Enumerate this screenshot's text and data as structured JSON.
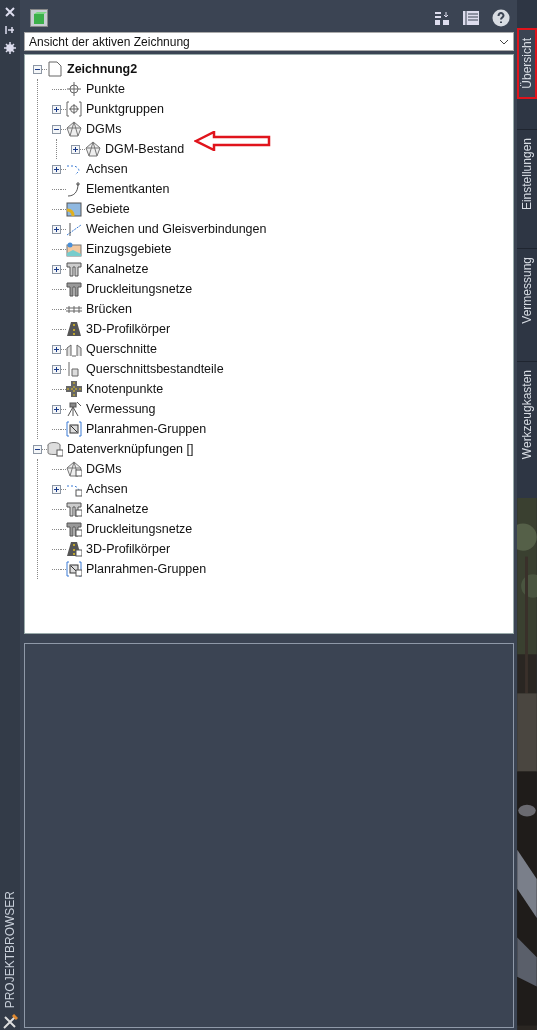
{
  "side_bar": {
    "title": "PROJEKTBROWSER"
  },
  "view_select": {
    "value": "Ansicht der aktiven Zeichnung"
  },
  "tree": [
    {
      "label": "Zeichnung2",
      "expanded": true,
      "children": [
        {
          "label": "Punkte"
        },
        {
          "label": "Punktgruppen",
          "expanded": false
        },
        {
          "label": "DGMs",
          "expanded": true,
          "children": [
            {
              "label": "DGM-Bestand",
              "expanded": false
            }
          ]
        },
        {
          "label": "Achsen",
          "expanded": false
        },
        {
          "label": "Elementkanten"
        },
        {
          "label": "Gebiete"
        },
        {
          "label": "Weichen und Gleisverbindungen",
          "expanded": false
        },
        {
          "label": "Einzugsgebiete"
        },
        {
          "label": "Kanalnetze",
          "expanded": false
        },
        {
          "label": "Druckleitungsnetze"
        },
        {
          "label": "Brücken"
        },
        {
          "label": "3D-Profilkörper"
        },
        {
          "label": "Querschnitte",
          "expanded": false
        },
        {
          "label": "Querschnittsbestandteile",
          "expanded": false
        },
        {
          "label": "Knotenpunkte"
        },
        {
          "label": "Vermessung",
          "expanded": false
        },
        {
          "label": "Planrahmen-Gruppen"
        }
      ]
    },
    {
      "label": "Datenverknüpfungen []",
      "expanded": true,
      "children": [
        {
          "label": "DGMs"
        },
        {
          "label": "Achsen",
          "expanded": false
        },
        {
          "label": "Kanalnetze"
        },
        {
          "label": "Druckleitungsnetze"
        },
        {
          "label": "3D-Profilkörper"
        },
        {
          "label": "Planrahmen-Gruppen"
        }
      ]
    }
  ],
  "tabs": [
    {
      "label": "Übersicht",
      "selected": true
    },
    {
      "label": "Einstellungen",
      "selected": false
    },
    {
      "label": "Vermessung",
      "selected": false
    },
    {
      "label": "Werkzeugkasten",
      "selected": false
    }
  ]
}
